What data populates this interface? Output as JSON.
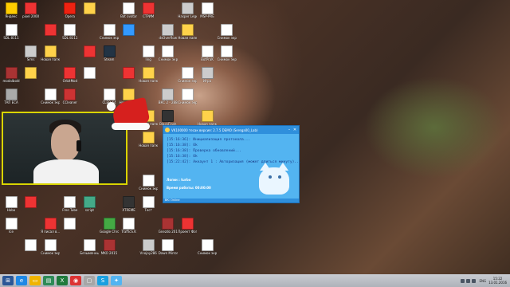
{
  "desktop": {
    "icons": [
      {
        "label": "Яндекс",
        "color": "#ffcc00",
        "glyph": "folder-icon"
      },
      {
        "label": "SDL 8111",
        "color": "#ffffff",
        "glyph": "file-icon"
      },
      {
        "label": "modalbold",
        "color": "#a33",
        "glyph": "app-icon"
      },
      {
        "label": "ТАП ЕСА",
        "color": "#aaa",
        "glyph": "app-icon"
      },
      {
        "label": "Hobo",
        "color": "#fff",
        "glyph": "file-icon"
      },
      {
        "label": "Ice",
        "color": "#fff",
        "glyph": "file-icon"
      },
      {
        "label": "pixel 2000",
        "color": "#e33",
        "glyph": "app-icon"
      },
      {
        "label": "Sims",
        "color": "#ccc",
        "glyph": "app-icon"
      },
      {
        "label": "",
        "color": "#ffd24a",
        "glyph": "folder-icon"
      },
      {
        "label": "",
        "color": "#e33",
        "glyph": "app-icon"
      },
      {
        "label": "",
        "color": "#fff",
        "glyph": "file-icon"
      },
      {
        "label": "",
        "color": "#e33",
        "glyph": "app-icon"
      },
      {
        "label": "Новая папка",
        "color": "#ffd24a",
        "glyph": "folder-icon"
      },
      {
        "label": "Снимок экрана",
        "color": "#fff",
        "glyph": "file-icon"
      },
      {
        "label": "Я писал в...",
        "color": "#e33",
        "glyph": "app-icon"
      },
      {
        "label": "Снимок экрана (7)",
        "color": "#fff",
        "glyph": "file-icon"
      },
      {
        "label": "Opera",
        "color": "#e21",
        "glyph": "app-icon"
      },
      {
        "label": "SDL 8111",
        "color": "#fff",
        "glyph": "file-icon"
      },
      {
        "label": "OrbitMod",
        "color": "#e33",
        "glyph": "app-icon"
      },
      {
        "label": "CCleaner",
        "color": "#c33",
        "glyph": "app-icon"
      },
      {
        "label": "Free Tube",
        "color": "#fff",
        "glyph": "file-icon"
      },
      {
        "label": "",
        "color": "#fff",
        "glyph": "file-icon"
      },
      {
        "label": "",
        "color": "#ffd24a",
        "glyph": "folder-icon"
      },
      {
        "label": "",
        "color": "#e33",
        "glyph": "app-icon"
      },
      {
        "label": "",
        "color": "#fff",
        "glyph": "file-icon"
      },
      {
        "label": "script",
        "color": "#4a8",
        "glyph": "app-icon"
      },
      {
        "label": "Безымянный",
        "color": "#fff",
        "glyph": "file-icon"
      },
      {
        "label": "Снимок экрана",
        "color": "#fff",
        "glyph": "file-icon"
      },
      {
        "label": "Steam",
        "color": "#234",
        "glyph": "app-icon"
      },
      {
        "label": "CLEO 64",
        "color": "#fff",
        "glyph": "file-icon"
      },
      {
        "label": "Google Chrome",
        "color": "#4a4",
        "glyph": "app-icon"
      },
      {
        "label": "MKO 2015",
        "color": "#a33",
        "glyph": "app-icon"
      },
      {
        "label": "Bot ovatar",
        "color": "#fff",
        "glyph": "file-icon"
      },
      {
        "label": "",
        "color": "#39f",
        "glyph": "app-icon"
      },
      {
        "label": "",
        "color": "#e33",
        "glyph": "app-icon"
      },
      {
        "label": "Новая папка",
        "color": "#ffd24a",
        "glyph": "folder-icon"
      },
      {
        "label": "XTREME",
        "color": "#333",
        "glyph": "app-icon"
      },
      {
        "label": "TrafficS.K",
        "color": "#fff",
        "glyph": "file-icon"
      },
      {
        "label": "СТРИМ",
        "color": "#e33",
        "glyph": "app-icon"
      },
      {
        "label": "ling",
        "color": "#fff",
        "glyph": "file-icon"
      },
      {
        "label": "Новая папка",
        "color": "#ffd24a",
        "glyph": "folder-icon"
      },
      {
        "label": "Новая папка",
        "color": "#ffd24a",
        "glyph": "folder-icon"
      },
      {
        "label": "Новая папка",
        "color": "#ffd24a",
        "glyph": "folder-icon"
      },
      {
        "label": "Снимок экрана",
        "color": "#fff",
        "glyph": "file-icon"
      },
      {
        "label": "Тест",
        "color": "#fff",
        "glyph": "file-icon"
      },
      {
        "label": "Vnojoy286",
        "color": "#ccc",
        "glyph": "app-icon"
      },
      {
        "label": "dsOverflow",
        "color": "#ccc",
        "glyph": "app-icon"
      },
      {
        "label": "Снимок экрана",
        "color": "#fff",
        "glyph": "file-icon"
      },
      {
        "label": "ВКС 2 - 2888",
        "color": "#ccc",
        "glyph": "app-icon"
      },
      {
        "label": "BlackFlash",
        "color": "#333",
        "glyph": "app-icon"
      },
      {
        "label": "Gnezdo 2015",
        "color": "#a33",
        "glyph": "app-icon"
      },
      {
        "label": "Dawn Mirror",
        "color": "#fff",
        "glyph": "file-icon"
      },
      {
        "label": "Hasper Legend",
        "color": "#ccc",
        "glyph": "app-icon"
      },
      {
        "label": "Новая папка",
        "color": "#ffd24a",
        "glyph": "folder-icon"
      },
      {
        "label": "Снимок экрана",
        "color": "#fff",
        "glyph": "file-icon"
      },
      {
        "label": "Снимок экрана",
        "color": "#fff",
        "glyph": "file-icon"
      },
      {
        "label": "Проект Фотошоп",
        "color": "#e33",
        "glyph": "app-icon"
      },
      {
        "label": "MSP-PRE",
        "color": "#fff",
        "glyph": "file-icon"
      },
      {
        "label": "BotPraK",
        "color": "#fff",
        "glyph": "file-icon"
      },
      {
        "label": "Игра",
        "color": "#ccc",
        "glyph": "app-icon"
      },
      {
        "label": "Новая папка",
        "color": "#ffd24a",
        "glyph": "folder-icon"
      },
      {
        "label": "Снимок экрана",
        "color": "#fff",
        "glyph": "file-icon"
      },
      {
        "label": "Снимок экрана",
        "color": "#fff",
        "glyph": "file-icon"
      },
      {
        "label": "Снимок экрана (74)",
        "color": "#fff",
        "glyph": "file-icon"
      }
    ]
  },
  "webcam": {
    "label": "webcam-overlay"
  },
  "app": {
    "title": "VK100000 тесак версия: 2.7.5 DEMO (Serega00_Lab)",
    "log": [
      "[15:16:36]: Инициализация протокола...",
      "[15:16:38]: Ok",
      "[15:16:38]: Проверка обновлений...",
      "[15:16:38]: Ok",
      "[15:22:42]: Аккаунт 1 : Авторизация (может длиться минуту)..."
    ],
    "login": "Логин : turbo",
    "uptime": "Время работы: 00:00:00",
    "status": "ВК: Online"
  },
  "taskbar": {
    "lang": "ENG",
    "time": "15:22",
    "date": "13.01.2016",
    "colors": {
      "accent": "#53b4f1",
      "taskbar": "#c0c4cc"
    }
  }
}
